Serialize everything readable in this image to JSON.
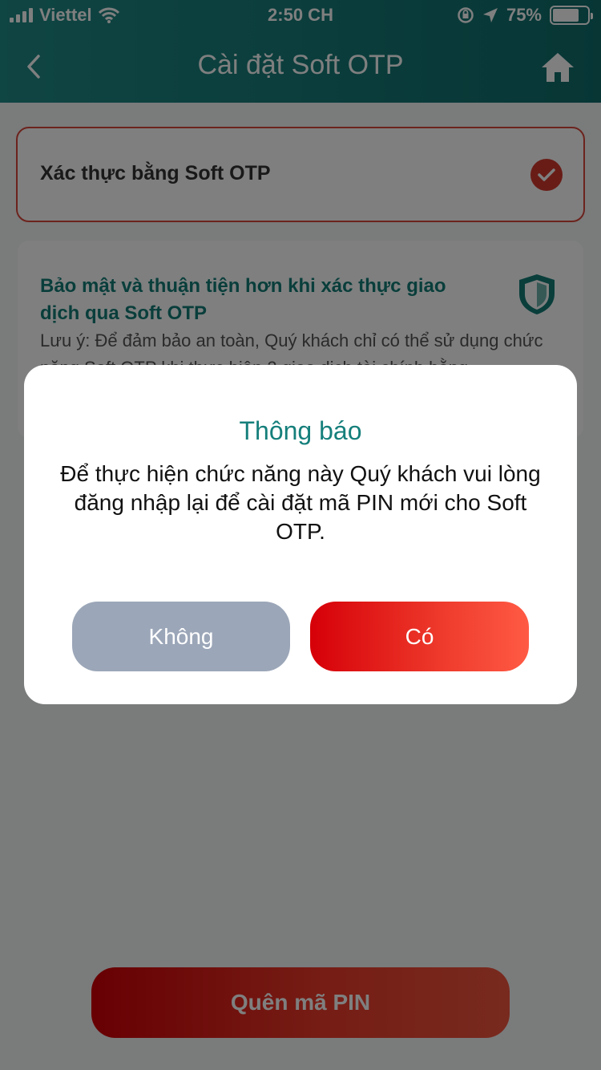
{
  "status_bar": {
    "carrier": "Viettel",
    "time": "2:50 CH",
    "battery_percent": "75%",
    "battery_level": 0.75
  },
  "header": {
    "title": "Cài đặt Soft OTP",
    "back_icon": "chevron-left-icon",
    "home_icon": "home-icon"
  },
  "otp_option": {
    "label": "Xác thực bằng Soft OTP",
    "checked": true
  },
  "info_card": {
    "title": "Bảo mật và thuận tiện hơn khi xác thực giao dịch qua Soft OTP",
    "note": "Lưu ý: Để đảm bảo an toàn, Quý khách chỉ có thể sử dụng chức năng Soft OTP khi thực hiện 2 giao dịch tài chính bằng"
  },
  "footer": {
    "forgot_pin_label": "Quên mã PIN"
  },
  "dialog": {
    "title": "Thông báo",
    "message": "Để thực hiện chức năng này Quý khách vui lòng đăng nhập lại để cài đặt mã PIN mới cho Soft OTP.",
    "no_label": "Không",
    "yes_label": "Có"
  },
  "colors": {
    "header": "#157a78",
    "accent_red": "#d2382c",
    "teal_text": "#127c76",
    "button_gray": "#9ba6b8"
  }
}
